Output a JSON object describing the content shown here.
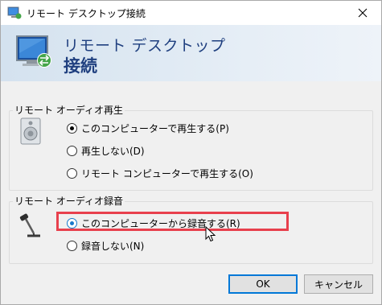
{
  "window": {
    "title": "リモート デスクトップ接続",
    "close_icon": "close-icon"
  },
  "header": {
    "line1": "リモート デスクトップ",
    "line2": "接続",
    "icon": "remote-desktop-icon"
  },
  "playback_group": {
    "legend": "リモート オーディオ再生",
    "icon": "speaker-icon",
    "options": [
      {
        "label": "このコンピューターで再生する(P)",
        "selected": true
      },
      {
        "label": "再生しない(D)",
        "selected": false
      },
      {
        "label": "リモート コンピューターで再生する(O)",
        "selected": false
      }
    ]
  },
  "record_group": {
    "legend": "リモート オーディオ録音",
    "icon": "microphone-icon",
    "options": [
      {
        "label": "このコンピューターから録音する(R)",
        "selected": true
      },
      {
        "label": "録音しない(N)",
        "selected": false
      }
    ]
  },
  "buttons": {
    "ok": "OK",
    "cancel": "キャンセル"
  },
  "colors": {
    "highlight": "#e8404d",
    "accent": "#0078d7",
    "header_text": "#1f3f7f"
  }
}
